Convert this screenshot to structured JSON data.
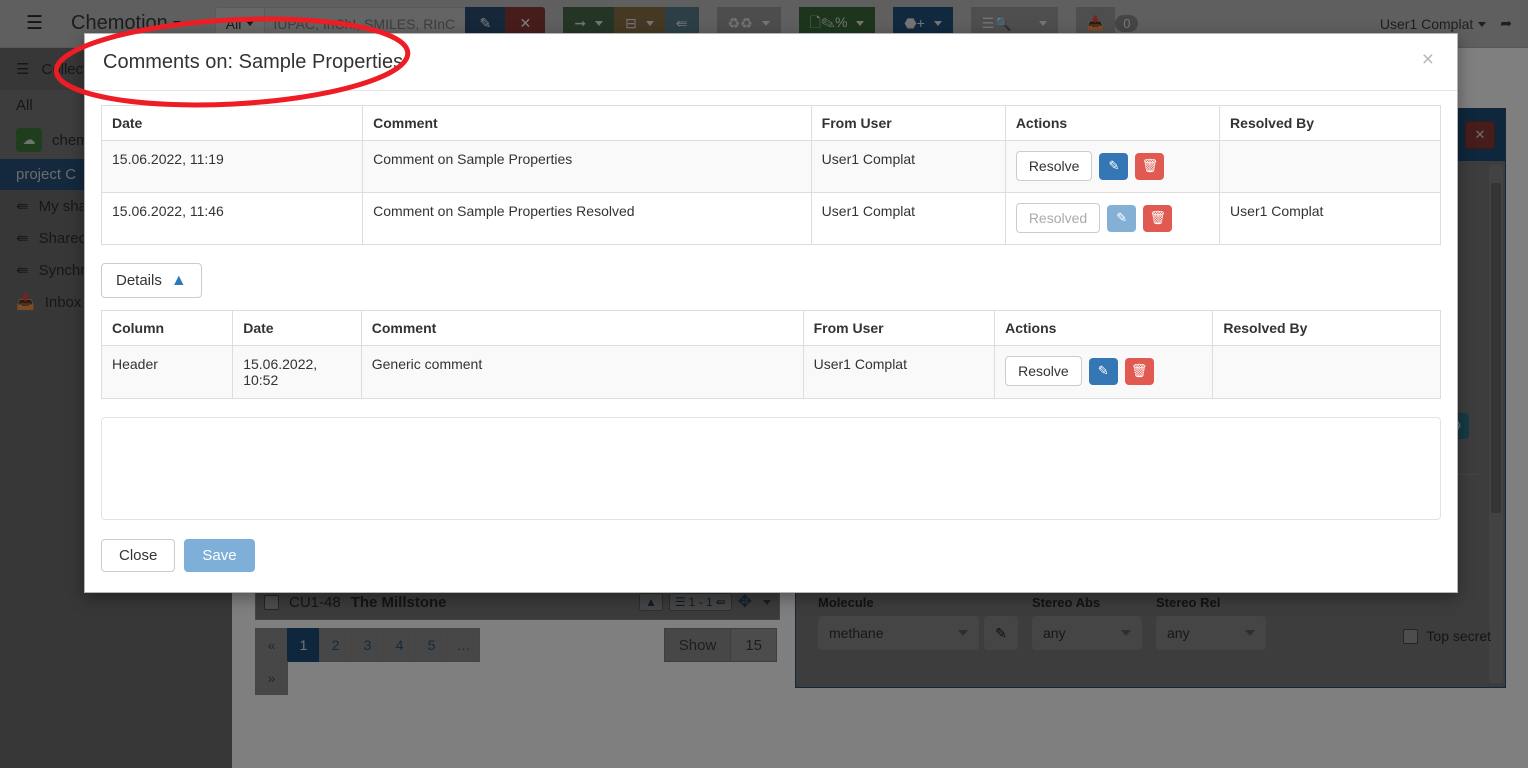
{
  "navbar": {
    "menu_icon": "hamburger-icon",
    "brand": "Chemotion",
    "search_scope": "All",
    "search_placeholder": "IUPAC, InChI, SMILES, RInC",
    "search_value": "",
    "edit_icon": "pencil-icon",
    "clear_icon": "times-icon",
    "groups": [
      {
        "icon": "arrow-right-icon",
        "name": "export-arrow-button"
      },
      {
        "icon": "minus-box-icon",
        "name": "remove-button"
      },
      {
        "icon": "share-icon",
        "name": "share-button"
      },
      {
        "icon": "microscope-icon",
        "name": "device-button"
      },
      {
        "icon": "report-icon",
        "name": "report-button"
      },
      {
        "icon": "hexagon-plus-icon",
        "name": "add-element-button"
      },
      {
        "icon": "search-list-icon",
        "name": "advanced-search-button"
      },
      {
        "icon": "inbox-icon",
        "name": "inbox-button"
      }
    ],
    "inbox_count": "0",
    "user": "User1 Complat",
    "logout_icon": "logout-icon"
  },
  "sidebar": {
    "header": "Collections",
    "items": [
      {
        "label": "All",
        "icon": "",
        "state": "sub"
      },
      {
        "label": "chemotion",
        "icon": "collection-icon",
        "state": "sub"
      },
      {
        "label": "project C",
        "icon": "",
        "state": "active"
      },
      {
        "label": "My shared collections",
        "icon": "share-icon",
        "state": "normal"
      },
      {
        "label": "Shared with me",
        "icon": "share-icon",
        "state": "normal"
      },
      {
        "label": "Synchronized",
        "icon": "share-icon",
        "state": "normal"
      },
      {
        "label": "Inbox",
        "icon": "inbox-icon",
        "state": "normal"
      }
    ]
  },
  "list": {
    "row": {
      "code": "CU1-48",
      "name": "The Millstone",
      "analysis_badge": "1 - 1",
      "up_icon": "triangle-up-icon",
      "list-icon": "list-icon",
      "share_icon": "share-icon",
      "move_icon": "arrows-move-icon",
      "caret_icon": "caret-down-icon"
    },
    "pagination": {
      "prev": "«",
      "pages": [
        "1",
        "2",
        "3",
        "4",
        "5",
        "…"
      ],
      "active": "1",
      "next": "»"
    },
    "show_label": "Show",
    "show_value": "15"
  },
  "detail_panel": {
    "copy_icon": "copy-icon",
    "close_icon": "times-icon",
    "settings_icon": "sliders-icon",
    "fields": [
      {
        "label": "Molecule",
        "value": "methane",
        "edit_icon": "pencil-icon"
      },
      {
        "label": "Stereo Abs",
        "value": "any"
      },
      {
        "label": "Stereo Rel",
        "value": "any"
      }
    ],
    "top_secret_label": "Top secret",
    "top_secret_checked": false
  },
  "modal": {
    "title": "Comments on: Sample Properties",
    "close_icon": "×",
    "comments_table": {
      "columns": [
        "Date",
        "Comment",
        "From User",
        "Actions",
        "Resolved By"
      ],
      "rows": [
        {
          "date": "15.06.2022, 11:19",
          "comment": "Comment on Sample Properties",
          "from_user": "User1 Complat",
          "action_label": "Resolve",
          "action_disabled": false,
          "edit_icon": "edit-icon",
          "delete_icon": "trash-icon",
          "resolved_by": ""
        },
        {
          "date": "15.06.2022, 11:46",
          "comment": "Comment on Sample Properties Resolved",
          "from_user": "User1 Complat",
          "action_label": "Resolved",
          "action_disabled": true,
          "edit_icon": "edit-icon",
          "delete_icon": "trash-icon",
          "resolved_by": "User1 Complat"
        }
      ]
    },
    "details_button": {
      "label": "Details",
      "chevron_icon": "chevron-up-icon"
    },
    "details_table": {
      "columns": [
        "Column",
        "Date",
        "Comment",
        "From User",
        "Actions",
        "Resolved By"
      ],
      "rows": [
        {
          "column": "Header",
          "date": "15.06.2022, 10:52",
          "comment": "Generic comment",
          "from_user": "User1 Complat",
          "action_label": "Resolve",
          "action_disabled": false,
          "edit_icon": "edit-icon",
          "delete_icon": "trash-icon",
          "resolved_by": ""
        }
      ]
    },
    "comment_input": {
      "value": "",
      "placeholder": ""
    },
    "footer": {
      "close_label": "Close",
      "save_label": "Save",
      "save_disabled": true
    }
  },
  "annotation": {
    "shape": "ellipse",
    "color": "#ee1c25",
    "target": "modal-title"
  },
  "colors": {
    "modal_bg": "#ffffff",
    "primary": "#3577b5",
    "danger": "#e05a52",
    "accent_teal": "#2c7488",
    "panel_header": "#1f4e79",
    "annotation_red": "#ee1c25"
  }
}
